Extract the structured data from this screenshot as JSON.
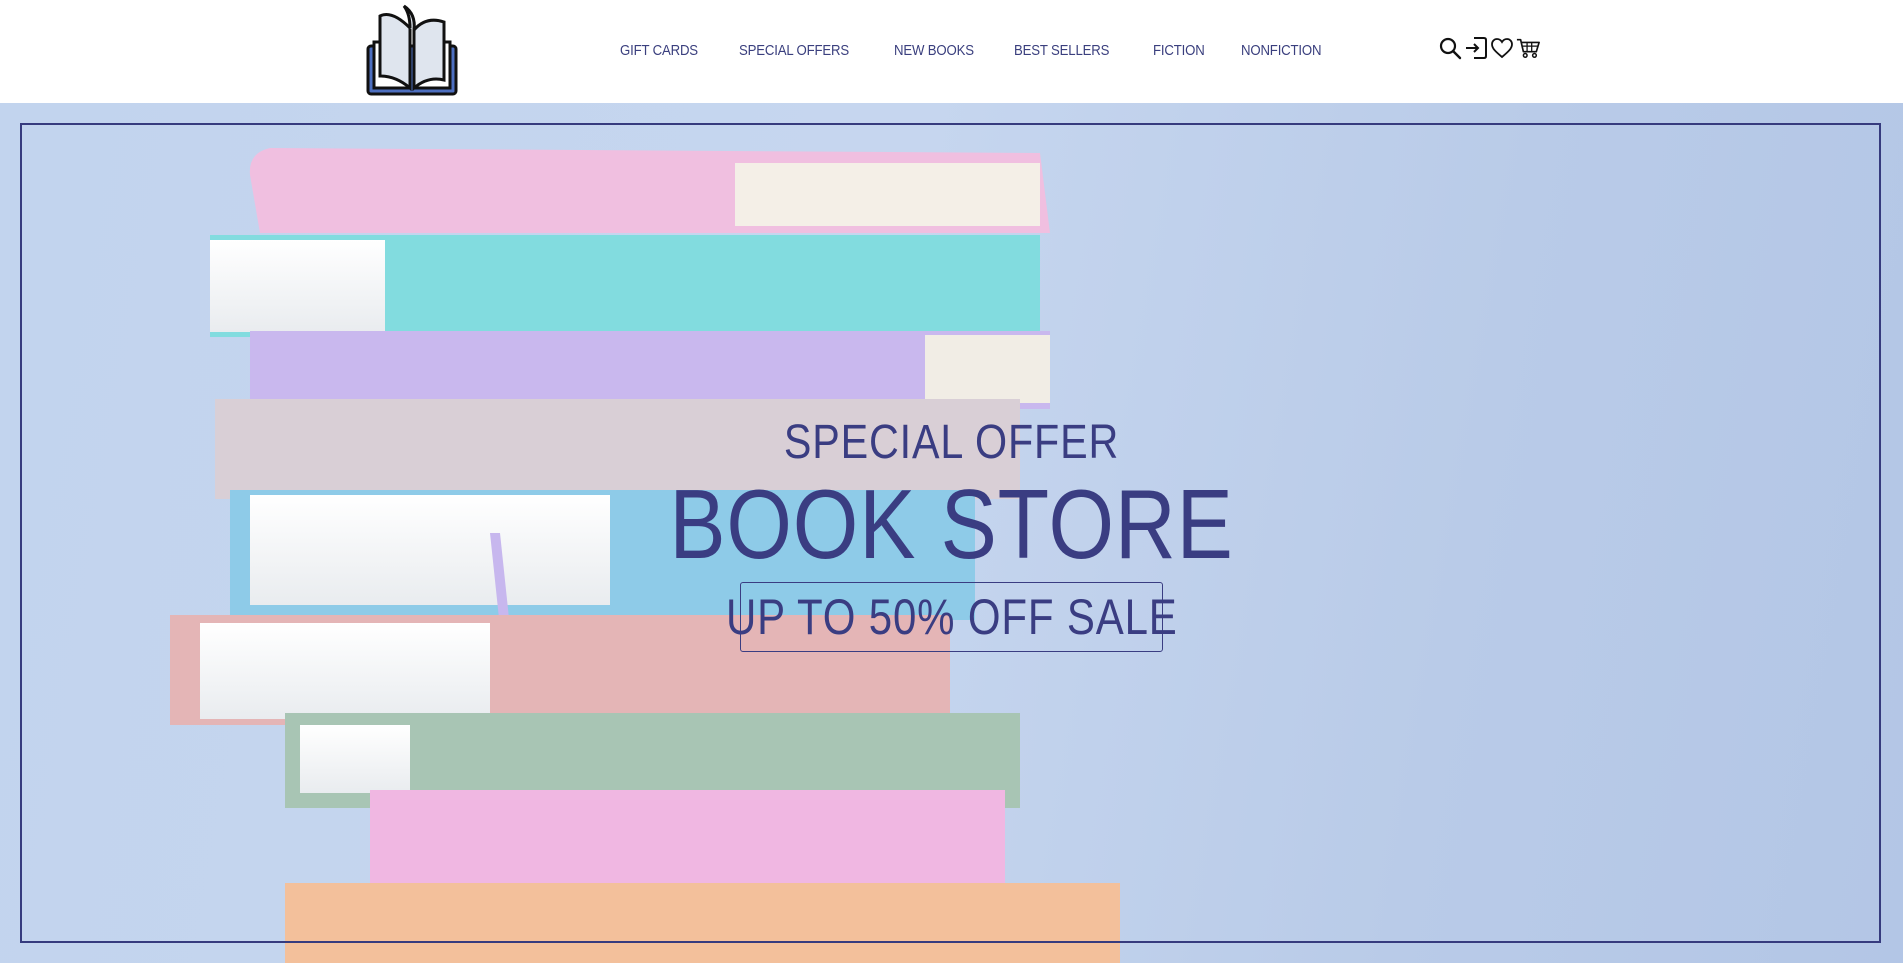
{
  "header": {
    "logo_icon": "open-book-logo",
    "nav": [
      {
        "label": "GIFT CARDS"
      },
      {
        "label": "SPECIAL OFFERS"
      },
      {
        "label": "NEW BOOKS"
      },
      {
        "label": "BEST SELLERS"
      },
      {
        "label": "FICTION"
      },
      {
        "label": "NONFICTION"
      }
    ],
    "icons": [
      "search-icon",
      "login-icon",
      "heart-icon",
      "cart-icon"
    ]
  },
  "hero": {
    "kicker": "SPECIAL OFFER",
    "title": "BOOK STORE",
    "cta": "UP TO 50% OFF SALE",
    "background_image": "stack of pastel books",
    "colors": {
      "text": "#3a3d82",
      "background": "#c2d4ee",
      "frame": "#363b7e"
    }
  }
}
